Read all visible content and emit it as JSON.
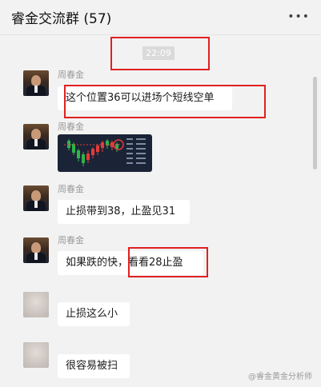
{
  "header": {
    "title": "睿金交流群 (57)",
    "more_icon": "more-horizontal-icon"
  },
  "timestamp": "22:09",
  "messages": [
    {
      "sender": "周春金",
      "text": "这个位置36可以进场个短线空单",
      "avatar": "photo"
    },
    {
      "sender": "周春金",
      "image": "candlestick-chart-thumbnail",
      "avatar": "photo"
    },
    {
      "sender": "周春金",
      "text": "止损带到38，止盈见31",
      "avatar": "photo"
    },
    {
      "sender": "周春金",
      "text": "如果跌的快，看看28止盈",
      "avatar": "photo"
    },
    {
      "sender": "",
      "text": "止损这么小",
      "avatar": "blurred"
    },
    {
      "sender": "",
      "text": "很容易被扫",
      "avatar": "blurred"
    }
  ],
  "watermark": "@睿金黄金分析师",
  "colors": {
    "highlight_box": "#e02020",
    "background": "#f2f2f2",
    "bubble": "#ffffff"
  }
}
